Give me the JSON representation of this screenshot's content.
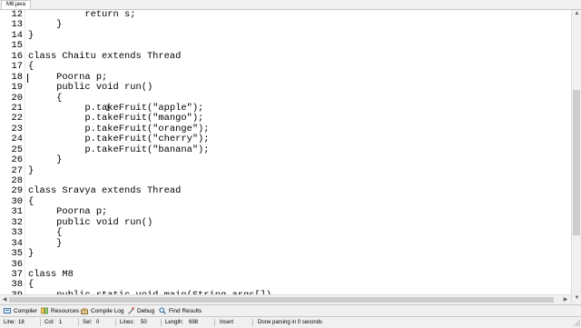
{
  "tab": {
    "label": "M8.java"
  },
  "code_lines": [
    {
      "num": "12",
      "text": "          return s;"
    },
    {
      "num": "13",
      "text": "     }"
    },
    {
      "num": "14",
      "text": "}"
    },
    {
      "num": "15",
      "text": ""
    },
    {
      "num": "16",
      "text": "class Chaitu extends Thread"
    },
    {
      "num": "17",
      "text": "{"
    },
    {
      "num": "18",
      "text": "     Poorna p;"
    },
    {
      "num": "19",
      "text": "     public void run()"
    },
    {
      "num": "20",
      "text": "     {"
    },
    {
      "num": "21",
      "text": "          p.takeFruit(\"apple\");"
    },
    {
      "num": "22",
      "text": "          p.takeFruit(\"mango\");"
    },
    {
      "num": "23",
      "text": "          p.takeFruit(\"orange\");"
    },
    {
      "num": "24",
      "text": "          p.takeFruit(\"cherry\");"
    },
    {
      "num": "25",
      "text": "          p.takeFruit(\"banana\");"
    },
    {
      "num": "26",
      "text": "     }"
    },
    {
      "num": "27",
      "text": "}"
    },
    {
      "num": "28",
      "text": ""
    },
    {
      "num": "29",
      "text": "class Sravya extends Thread"
    },
    {
      "num": "30",
      "text": "{"
    },
    {
      "num": "31",
      "text": "     Poorna p;"
    },
    {
      "num": "32",
      "text": "     public void run()"
    },
    {
      "num": "33",
      "text": "     {"
    },
    {
      "num": "34",
      "text": "     }"
    },
    {
      "num": "35",
      "text": "}"
    },
    {
      "num": "36",
      "text": ""
    },
    {
      "num": "37",
      "text": "class M8"
    },
    {
      "num": "38",
      "text": "{"
    },
    {
      "num": "39",
      "text": "     public static void main(String args[])"
    }
  ],
  "bottom_tabs": [
    {
      "label": "Compiler",
      "icon": "compiler-icon"
    },
    {
      "label": "Resources",
      "icon": "resources-icon"
    },
    {
      "label": "Compile Log",
      "icon": "compile-log-icon"
    },
    {
      "label": "Debug",
      "icon": "debug-icon"
    },
    {
      "label": "Find Results",
      "icon": "find-results-icon"
    }
  ],
  "status": {
    "line_label": "Line:",
    "line_value": "18",
    "col_label": "Col:",
    "col_value": "1",
    "sel_label": "Sel:",
    "sel_value": "0",
    "lines_label": "Lines:",
    "lines_value": "50",
    "length_label": "Length:",
    "length_value": "698",
    "mode": "Insert",
    "message": "Done parsing in 0 seconds"
  },
  "colors": {
    "editor_bg": "#ffffff",
    "chrome_bg": "#f0f0f0",
    "text": "#000000"
  }
}
